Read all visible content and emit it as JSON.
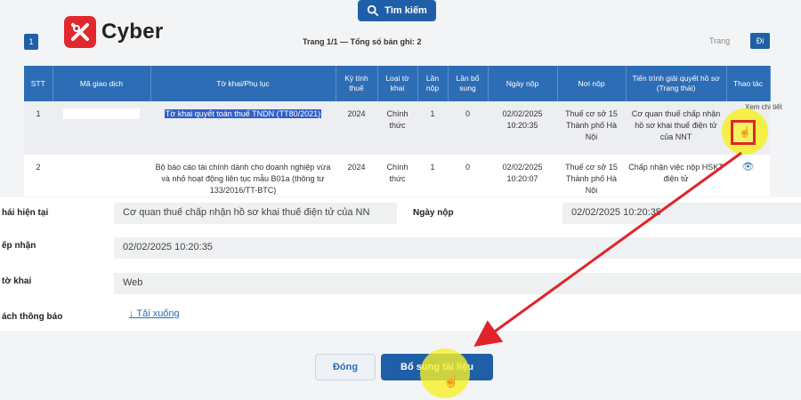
{
  "toolbar": {
    "search_label": "Tìm kiếm"
  },
  "brand": {
    "name": "Cyber",
    "color": "#e0282e"
  },
  "paging": {
    "current_page": "1",
    "summary": "Trang 1/1 — Tổng số bản ghi: 2",
    "goto_label": "Trang",
    "goto_button": "Đi"
  },
  "table": {
    "headers": [
      "STT",
      "Mã giao dịch",
      "Tờ khai/Phụ lục",
      "Kỳ tính thuế",
      "Loại tờ khai",
      "Lần nộp",
      "Lần bổ sung",
      "Ngày nộp",
      "Nơi nộp",
      "Tiến trình giải quyết hồ sơ (Trạng thái)",
      "Thao tác"
    ],
    "rows": [
      {
        "stt": "1",
        "ma_gd": "",
        "to_khai": "Tờ khai quyết toán thuế TNDN (TT80/2021)",
        "ky_tinh_thue": "2024",
        "loai": "Chính thức",
        "lan_nop": "1",
        "lan_bo_sung": "0",
        "ngay_nop": "02/02/2025 10:20:35",
        "noi_nop": "Thuế cơ sở 15 Thành phố Hà Nội",
        "tien_trinh": "Cơ quan thuế chấp nhận hồ sơ khai thuế điện tử của NNT"
      },
      {
        "stt": "2",
        "ma_gd": "",
        "to_khai": "Bộ báo cáo tài chính dành cho doanh nghiệp vừa và nhỏ hoạt động liên tục mẫu B01a (thông tư 133/2016/TT-BTC)",
        "ky_tinh_thue": "2024",
        "loai": "Chính thức",
        "lan_nop": "1",
        "lan_bo_sung": "0",
        "ngay_nop": "02/02/2025 10:20:07",
        "noi_nop": "Thuế cơ sở 15 Thành phố Hà Nội",
        "tien_trinh": "Chấp nhận việc nộp HSKT điện tử"
      }
    ],
    "action_tooltip": "Xem chi tiết"
  },
  "detail": {
    "status_label": "hái hiện tại",
    "status_value": "Cơ quan thuế chấp nhận hồ sơ khai thuế điện tử của NN",
    "date_label": "Ngày nộp",
    "date_value": "02/02/2025 10:20:35",
    "accept_label": "ếp nhận",
    "accept_value": "02/02/2025 10:20:35",
    "form_label": "tờ khai",
    "form_value": "Web",
    "notice_label": "ách thông báo",
    "notice_link": "↓ Tải xuống"
  },
  "actions": {
    "close_label": "Đóng",
    "add_label": "Bổ sung tài liệu"
  },
  "colors": {
    "primary": "#1f5fa8",
    "header": "#2d6db5",
    "highlight": "#2f5fc8",
    "annotation_red": "#e0242a",
    "cursor_yellow": "#f6f028"
  }
}
